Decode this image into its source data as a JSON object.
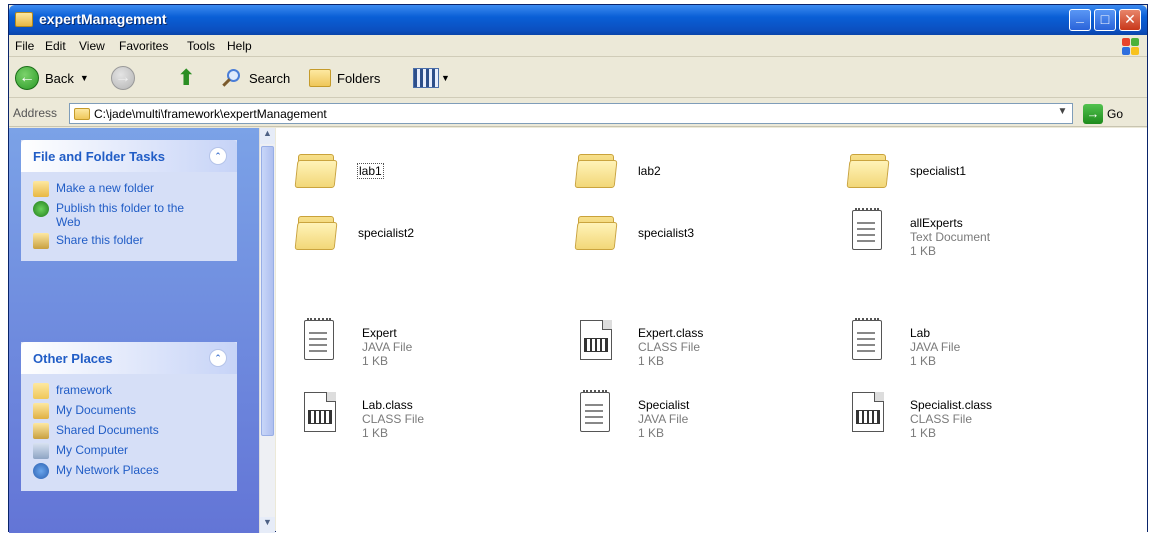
{
  "window": {
    "title": "expertManagement"
  },
  "menu": [
    "File",
    "Edit",
    "View",
    "Favorites",
    "Tools",
    "Help"
  ],
  "toolbar": {
    "back": "Back",
    "search": "Search",
    "folders": "Folders"
  },
  "address": {
    "label": "Address",
    "path": "C:\\jade\\multi\\framework\\expertManagement",
    "go": "Go"
  },
  "file_tasks": {
    "title": "File and Folder Tasks",
    "items": [
      "Make a new folder",
      "Publish this folder to the Web",
      "Share this folder"
    ]
  },
  "other_places": {
    "title": "Other Places",
    "items": [
      "framework",
      "My Documents",
      "Shared Documents",
      "My Computer",
      "My Network Places"
    ]
  },
  "files": [
    {
      "name": "lab1",
      "kind": "folder"
    },
    {
      "name": "lab2",
      "kind": "folder"
    },
    {
      "name": "specialist1",
      "kind": "folder"
    },
    {
      "name": "specialist2",
      "kind": "folder"
    },
    {
      "name": "specialist3",
      "kind": "folder"
    },
    {
      "name": "allExperts",
      "kind": "text",
      "type": "Text Document",
      "size": "1 KB"
    },
    {
      "name": "Expert",
      "kind": "java",
      "type": "JAVA File",
      "size": "1 KB"
    },
    {
      "name": "Expert.class",
      "kind": "class",
      "type": "CLASS File",
      "size": "1 KB"
    },
    {
      "name": "Lab",
      "kind": "java",
      "type": "JAVA File",
      "size": "1 KB"
    },
    {
      "name": "Lab.class",
      "kind": "class",
      "type": "CLASS File",
      "size": "1 KB"
    },
    {
      "name": "Specialist",
      "kind": "java",
      "type": "JAVA File",
      "size": "1 KB"
    },
    {
      "name": "Specialist.class",
      "kind": "class",
      "type": "CLASS File",
      "size": "1 KB"
    }
  ],
  "colors": {
    "titlebar": "#0a5fd6",
    "taskpane": "#6375d6",
    "link": "#215dc6"
  }
}
